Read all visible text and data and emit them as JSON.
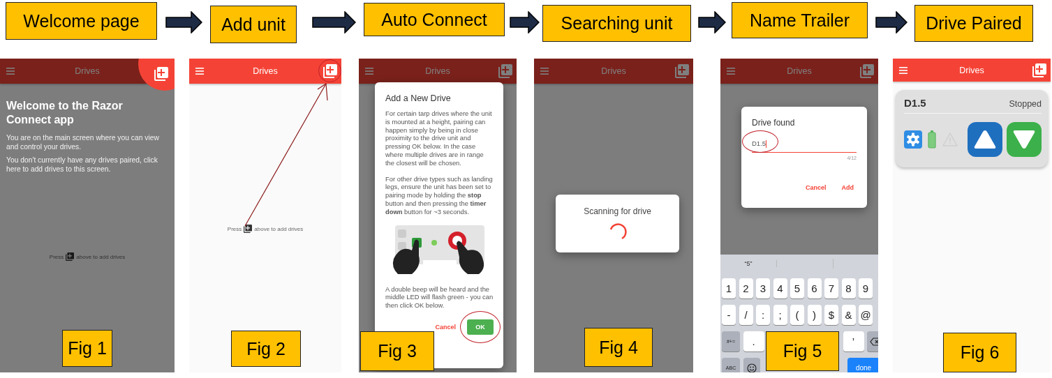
{
  "steps": [
    {
      "label": "Welcome page"
    },
    {
      "label": "Add unit"
    },
    {
      "label": "Auto Connect"
    },
    {
      "label": "Searching unit"
    },
    {
      "label": "Name Trailer"
    },
    {
      "label": "Drive Paired"
    }
  ],
  "figures": [
    {
      "kind": "welcome",
      "caption": "Fig 1",
      "dimmed": true,
      "app_bar": {
        "title": "Drives"
      },
      "hint": {
        "before": "Press",
        "after": "above to add drives"
      },
      "tour": {
        "title": "Welcome to the Razor Connect app",
        "paragraphs": [
          "You are on the main screen where you can view and control your drives.",
          "You don't currently have any drives paired, click here to add drives to this screen."
        ]
      }
    },
    {
      "kind": "empty",
      "caption": "Fig 2",
      "dimmed": false,
      "pointer_arrow": true,
      "app_bar": {
        "title": "Drives",
        "add_highlighted": true
      },
      "hint": {
        "before": "Press",
        "after": "above to add drives"
      }
    },
    {
      "kind": "info_dialog",
      "caption": "Fig 3",
      "dimmed": true,
      "app_bar": {
        "title": "Drives",
        "add_highlighted": false
      },
      "dialog": {
        "title": "Add a New Drive",
        "paragraphs": [
          "For certain tarp drives where the unit is mounted at a height, pairing can happen simply by being in close proximity to the drive unit and pressing OK below. In the case where multiple drives are in range the closest will be chosen.",
          "For other drive types such as landing legs, ensure the unit has been set to pairing mode by holding the **stop** button and then pressing the **timer down** button for ~3 seconds.",
          "A double beep will be heard and the middle LED will flash green - you can then click OK below."
        ],
        "buttons": [
          {
            "label": "Cancel",
            "kind": "text",
            "highlighted": false
          },
          {
            "label": "OK",
            "kind": "filled",
            "highlighted": true
          }
        ]
      }
    },
    {
      "kind": "progress_dialog",
      "caption": "Fig 4",
      "dimmed": true,
      "app_bar": {
        "title": "Drives",
        "add_highlighted": false
      },
      "dialog": {
        "title": "Scanning for drive"
      }
    },
    {
      "kind": "name_dialog",
      "caption": "Fig 5",
      "dimmed": true,
      "app_bar": {
        "title": "Drives",
        "add_highlighted": false
      },
      "dialog": {
        "title": "Drive found",
        "value": "D1.5",
        "highlighted": true,
        "counter": "4/12",
        "buttons": [
          {
            "label": "Cancel",
            "kind": "text",
            "highlighted": false
          },
          {
            "label": "Add",
            "kind": "text",
            "highlighted": false
          }
        ]
      },
      "keyboard": {
        "suggestions": [
          "“5”"
        ],
        "rows": [
          {
            "left": [
              {
                "label": "1",
                "kind": "key"
              },
              {
                "label": "2",
                "kind": "key"
              },
              {
                "label": "3",
                "kind": "key"
              },
              {
                "label": "4",
                "kind": "key"
              },
              {
                "label": "5",
                "kind": "key"
              },
              {
                "label": "6",
                "kind": "key"
              },
              {
                "label": "7",
                "kind": "key"
              },
              {
                "label": "8",
                "kind": "key"
              },
              {
                "label": "9",
                "kind": "key"
              }
            ]
          },
          {
            "left": [
              {
                "label": "-",
                "kind": "key"
              },
              {
                "label": "/",
                "kind": "key"
              },
              {
                "label": ":",
                "kind": "key"
              },
              {
                "label": ";",
                "kind": "key"
              },
              {
                "label": "(",
                "kind": "key"
              },
              {
                "label": ")",
                "kind": "key"
              },
              {
                "label": "$",
                "kind": "key"
              },
              {
                "label": "&",
                "kind": "key"
              },
              {
                "label": "@",
                "kind": "key"
              }
            ]
          },
          {
            "left": [
              {
                "label": "#+=",
                "kind": "function"
              },
              {
                "label": ".",
                "kind": "wide"
              }
            ],
            "right": [
              {
                "label": "’",
                "kind": "wide"
              },
              {
                "kind": "backspace"
              }
            ]
          },
          {
            "left": [
              {
                "label": "ABC",
                "kind": "function"
              },
              {
                "kind": "emoji"
              }
            ],
            "right": [
              {
                "label": "done",
                "kind": "action"
              }
            ]
          }
        ]
      }
    },
    {
      "kind": "drive_list",
      "caption": "Fig 6",
      "dimmed": false,
      "app_bar": {
        "title": "Drives",
        "add_highlighted": false
      },
      "drives": [
        {
          "name": "D1.5",
          "status": "Stopped"
        }
      ]
    }
  ]
}
